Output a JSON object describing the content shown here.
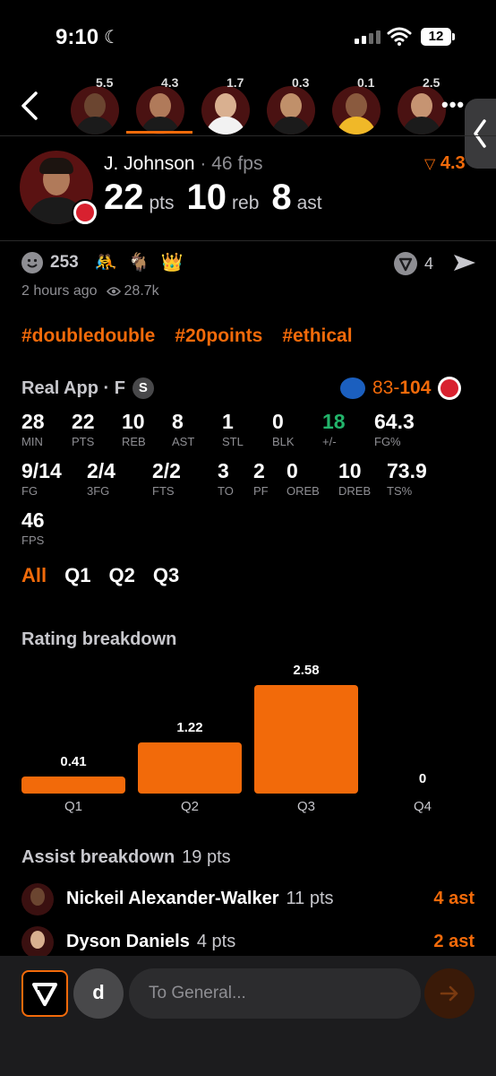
{
  "status_bar": {
    "time": "9:10",
    "battery": "12"
  },
  "player_strip": [
    {
      "score": "5.5",
      "skin": "#6b4530",
      "jersey": "#1b1b1b"
    },
    {
      "score": "4.3",
      "skin": "#b07a5a",
      "jersey": "#1b1b1b"
    },
    {
      "score": "1.7",
      "skin": "#d9b090",
      "jersey": "#f2f2f2"
    },
    {
      "score": "0.3",
      "skin": "#c0906a",
      "jersey": "#1b1b1b"
    },
    {
      "score": "0.1",
      "skin": "#8a5a3e",
      "jersey": "#f0b828"
    },
    {
      "score": "2.5",
      "skin": "#c69472",
      "jersey": "#1b1b1b"
    }
  ],
  "player": {
    "name": "J. Johnson",
    "fps": "· 46 fps",
    "rating": "4.3",
    "pts": "22",
    "pts_label": "pts",
    "reb": "10",
    "reb_label": "reb",
    "ast": "8",
    "ast_label": "ast"
  },
  "post": {
    "reactions_count": "253",
    "emojis": [
      "🤼",
      "🐐",
      "👑"
    ],
    "feed_count": "4",
    "time_ago": "2 hours ago",
    "views": "28.7k",
    "hashtags": [
      "#doubledouble",
      "#20points",
      "#ethical"
    ]
  },
  "box": {
    "source": "Real App · F",
    "badge": "S",
    "opp_score": "83-",
    "team_score": "104",
    "stats": [
      {
        "v": "28",
        "l": "MIN"
      },
      {
        "v": "22",
        "l": "PTS"
      },
      {
        "v": "10",
        "l": "REB"
      },
      {
        "v": "8",
        "l": "AST"
      },
      {
        "v": "1",
        "l": "STL"
      },
      {
        "v": "0",
        "l": "BLK"
      },
      {
        "v": "18",
        "l": "+/-"
      },
      {
        "v": "64.3",
        "l": "FG%"
      },
      {
        "v": "9/14",
        "l": "FG"
      },
      {
        "v": "2/4",
        "l": "3FG"
      },
      {
        "v": "2/2",
        "l": "FTS"
      },
      {
        "v": "3",
        "l": "TO"
      },
      {
        "v": "2",
        "l": "PF"
      },
      {
        "v": "0",
        "l": "OREB"
      },
      {
        "v": "10",
        "l": "DREB"
      },
      {
        "v": "73.9",
        "l": "TS%"
      },
      {
        "v": "46",
        "l": "FPS"
      }
    ]
  },
  "quarter_tabs": [
    "All",
    "Q1",
    "Q2",
    "Q3"
  ],
  "chart_data": {
    "type": "bar",
    "title": "Rating breakdown",
    "categories": [
      "Q1",
      "Q2",
      "Q3",
      "Q4"
    ],
    "values": [
      0.41,
      1.22,
      2.58,
      0
    ],
    "labels": [
      "0.41",
      "1.22",
      "2.58",
      "0"
    ],
    "color": "#f26a0a"
  },
  "assists": {
    "title": "Assist breakdown",
    "total": "19 pts",
    "rows": [
      {
        "name": "Nickeil Alexander-Walker",
        "pts": "11 pts",
        "ast": "4 ast"
      },
      {
        "name": "Dyson Daniels",
        "pts": "4 pts",
        "ast": "2 ast"
      }
    ]
  },
  "composer": {
    "user_initial": "d",
    "placeholder": "To General..."
  },
  "colors": {
    "accent": "#f26a0a",
    "positive": "#22b36a",
    "background": "#000000"
  }
}
